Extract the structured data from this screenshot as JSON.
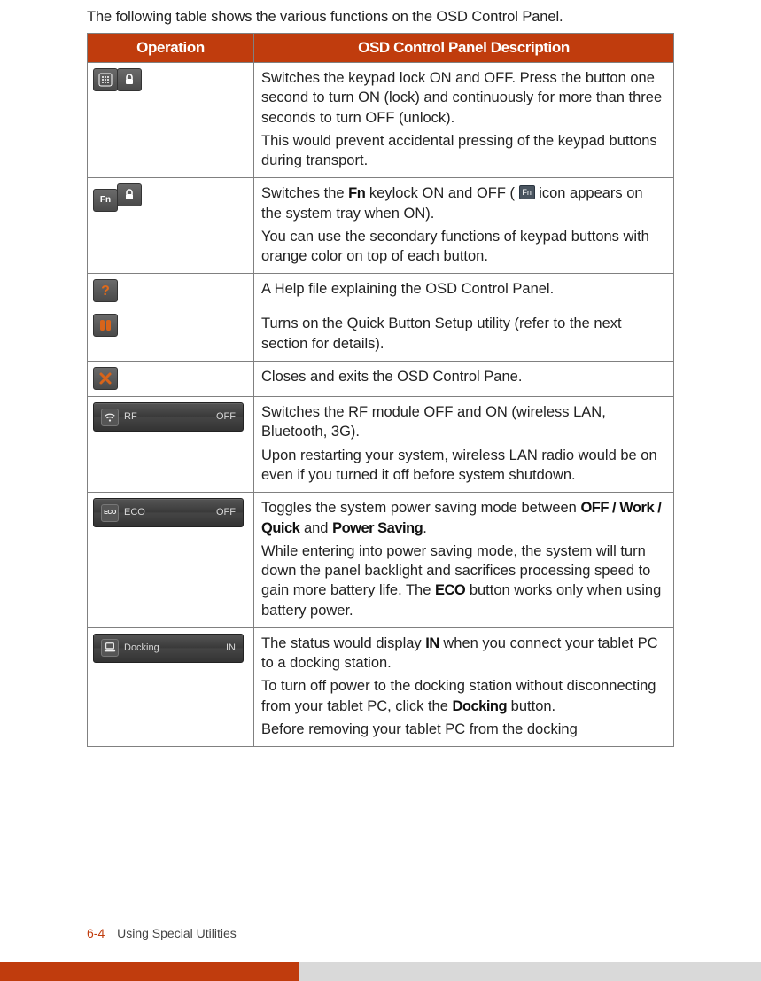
{
  "intro": "The following table shows the various functions on the OSD Control Panel.",
  "headers": {
    "op": "Operation",
    "desc": "OSD Control Panel Description"
  },
  "rows": {
    "keypad_lock": {
      "icon_name": "keypad-lock-icon",
      "p1": "Switches the keypad lock ON and OFF. Press the button one second to turn ON (lock) and continuously for more than three seconds to turn OFF (unlock).",
      "p2": "This would prevent accidental pressing of the keypad buttons during transport."
    },
    "fn_lock": {
      "icon_name": "fn-lock-icon",
      "p1a": "Switches the ",
      "p1b_fn": "Fn",
      "p1c": " keylock ON and OFF ( ",
      "tray_icon_name": "fn-tray-icon",
      "tray_glyph": "Fn",
      "p1d": " icon appears on the system tray when ON).",
      "p2": "You can use the secondary functions of keypad buttons with orange color on top of each button."
    },
    "help": {
      "icon_name": "help-icon",
      "p1": "A Help file explaining the OSD Control Panel."
    },
    "quick_setup": {
      "icon_name": "quick-button-setup-icon",
      "p1": "Turns on the Quick Button Setup utility (refer to the next section for details)."
    },
    "close": {
      "icon_name": "close-icon",
      "p1": "Closes and exits the OSD Control Pane."
    },
    "rf": {
      "bar_icon_name": "rf-status-bar",
      "bar_label": "RF",
      "bar_state": "OFF",
      "p1": "Switches the RF module OFF and ON (wireless LAN, Bluetooth, 3G).",
      "p2": "Upon restarting your system, wireless LAN radio would be on even if you turned it off before system shutdown."
    },
    "eco": {
      "bar_icon_name": "eco-status-bar",
      "bar_label": "ECO",
      "bar_state": "OFF",
      "p1a": "Toggles the system power saving mode between ",
      "p1_modes": "OFF / Work / Quick",
      "p1b": " and ",
      "p1_saving": "Power Saving",
      "p1c": ".",
      "p2a": "While entering into power saving mode, the system will turn down the panel backlight and sacrifices processing speed to gain more battery life. The ",
      "p2_eco": "ECO",
      "p2b": " button works only when using battery power."
    },
    "docking": {
      "bar_icon_name": "docking-status-bar",
      "bar_label": "Docking",
      "bar_state": "IN",
      "p1a": "The status would display ",
      "p1_in": "IN",
      "p1b": " when you connect your tablet PC to a docking station.",
      "p2a": "To turn off power to the docking station without disconnecting from your tablet PC, click the ",
      "p2_dock": "Docking",
      "p2b": " button.",
      "p3": "Before removing your tablet PC from the docking"
    }
  },
  "footer": {
    "page": "6-4",
    "section": "Using Special Utilities"
  }
}
